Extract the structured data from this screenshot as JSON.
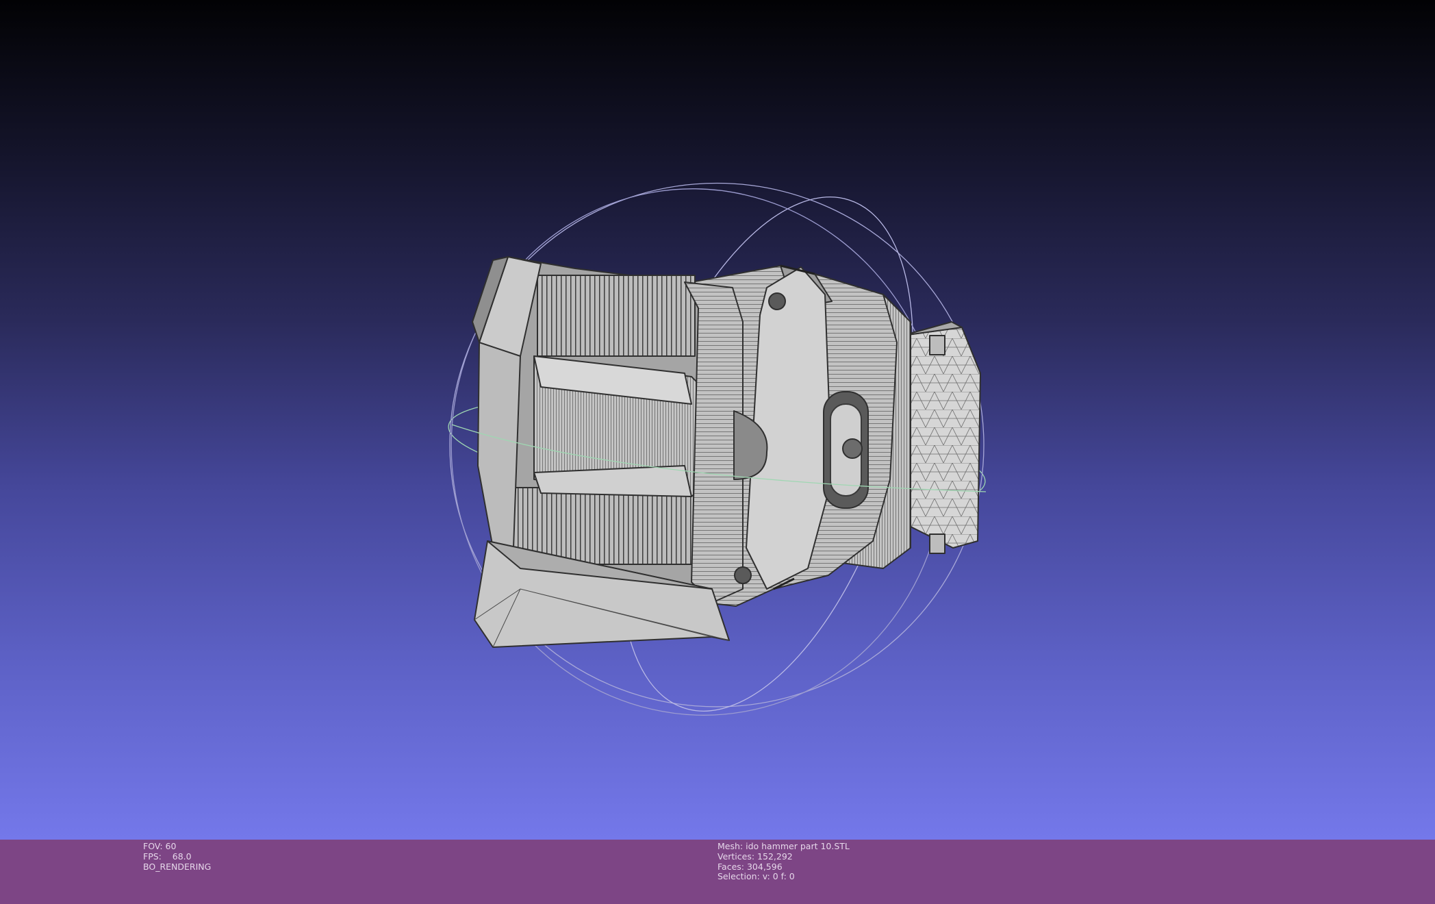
{
  "left_info": {
    "fov": "FOV: 60",
    "fps": "FPS:    68.0",
    "render_mode": "BO_RENDERING"
  },
  "right_info": {
    "mesh": "Mesh: ido hammer part 10.STL",
    "vertices": "Vertices: 152,292",
    "faces": "Faces: 304,596",
    "selection": "Selection: v: 0 f: 0"
  },
  "colors": {
    "background_top": "#020204",
    "background_bottom": "#7478ea",
    "status_bar": "#7d4585",
    "mesh_fill": "#c6c6c6",
    "mesh_wire": "#3a3a3a",
    "trackball_horizontal": "#9fd7b2",
    "trackball_vertical": "#b9b9e6"
  },
  "icons": {
    "trackball": "trackball-gizmo",
    "mesh": "3d-mesh-model"
  }
}
